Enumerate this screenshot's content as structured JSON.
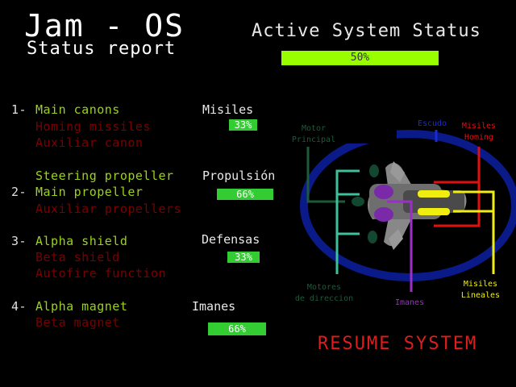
{
  "header": {
    "title": "Jam - OS",
    "subtitle": "Status report",
    "system_status_label": "Active System Status",
    "system_status_value": "50%",
    "system_status_fraction": 0.5
  },
  "groups": [
    {
      "number": "1-",
      "items": [
        {
          "label": "Main canons",
          "active": true
        },
        {
          "label": "Homing missiles",
          "active": false
        },
        {
          "label": "Auxiliar canon",
          "active": false
        }
      ],
      "category": "Misiles",
      "percent_label": "33%",
      "percent": 33
    },
    {
      "number": "2-",
      "items": [
        {
          "label": "Steering propeller",
          "active": true
        },
        {
          "label": "Main propeller",
          "active": true
        },
        {
          "label": "Auxiliar propellers",
          "active": false
        }
      ],
      "category": "Propulsión",
      "percent_label": "66%",
      "percent": 66
    },
    {
      "number": "3-",
      "items": [
        {
          "label": "Alpha shield",
          "active": true
        },
        {
          "label": "Beta shield",
          "active": false
        },
        {
          "label": "Autofire function",
          "active": false
        }
      ],
      "category": "Defensas",
      "percent_label": "33%",
      "percent": 33
    },
    {
      "number": "4-",
      "items": [
        {
          "label": "Alpha magnet",
          "active": true
        },
        {
          "label": "Beta magnet",
          "active": false
        }
      ],
      "category": "Imanes",
      "percent_label": "66%",
      "percent": 66
    }
  ],
  "diagram": {
    "labels": {
      "motor_principal_1": "Motor",
      "motor_principal_2": "Principal",
      "escudo": "Escudo",
      "misiles_homing_1": "Misiles",
      "misiles_homing_2": "Homing",
      "motores_direccion_1": "Motores",
      "motores_direccion_2": "de direccion",
      "imanes": "Imanes",
      "misiles_lineales_1": "Misiles",
      "misiles_lineales_2": "Lineales"
    },
    "colors": {
      "shield": "#0a1a88",
      "motor": "#1e5a3a",
      "steering": "#3ec09a",
      "magnet": "#9b2fc7",
      "homing": "#e01010",
      "linear": "#f0ee10",
      "escudo_label": "#1a2ad8"
    }
  },
  "resume_label": "RESUME SYSTEM"
}
